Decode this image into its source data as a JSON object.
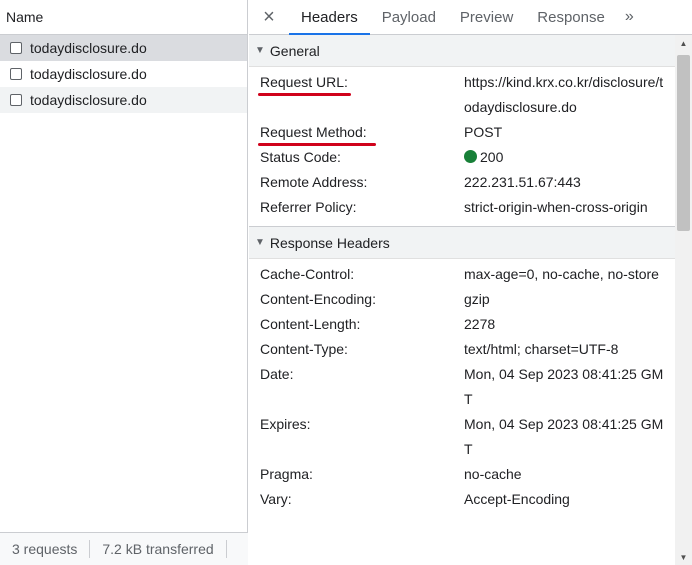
{
  "requests_panel": {
    "header": "Name",
    "requests": [
      {
        "name": "todaydisclosure.do"
      },
      {
        "name": "todaydisclosure.do"
      },
      {
        "name": "todaydisclosure.do"
      }
    ],
    "footer": {
      "count": "3 requests",
      "transferred": "7.2 kB transferred"
    }
  },
  "tabs": {
    "close_icon": "×",
    "items": [
      "Headers",
      "Payload",
      "Preview",
      "Response"
    ],
    "active": "Headers",
    "more_icon": "»"
  },
  "general": {
    "title": "General",
    "rows": [
      {
        "key": "Request URL:",
        "value": "https://kind.krx.co.kr/disclosure/todaydisclosure.do"
      },
      {
        "key": "Request Method:",
        "value": "POST"
      },
      {
        "key": "Status Code:",
        "value": "200"
      },
      {
        "key": "Remote Address:",
        "value": "222.231.51.67:443"
      },
      {
        "key": "Referrer Policy:",
        "value": "strict-origin-when-cross-origin"
      }
    ]
  },
  "response_headers": {
    "title": "Response Headers",
    "rows": [
      {
        "key": "Cache-Control:",
        "value": "max-age=0, no-cache, no-store"
      },
      {
        "key": "Content-Encoding:",
        "value": "gzip"
      },
      {
        "key": "Content-Length:",
        "value": "2278"
      },
      {
        "key": "Content-Type:",
        "value": "text/html; charset=UTF-8"
      },
      {
        "key": "Date:",
        "value": "Mon, 04 Sep 2023 08:41:25 GMT"
      },
      {
        "key": "Expires:",
        "value": "Mon, 04 Sep 2023 08:41:25 GMT"
      },
      {
        "key": "Pragma:",
        "value": "no-cache"
      },
      {
        "key": "Vary:",
        "value": "Accept-Encoding"
      }
    ]
  },
  "colors": {
    "status_ok": "#188038",
    "annotation_underline": "#d0021b",
    "active_tab": "#1a73e8"
  }
}
